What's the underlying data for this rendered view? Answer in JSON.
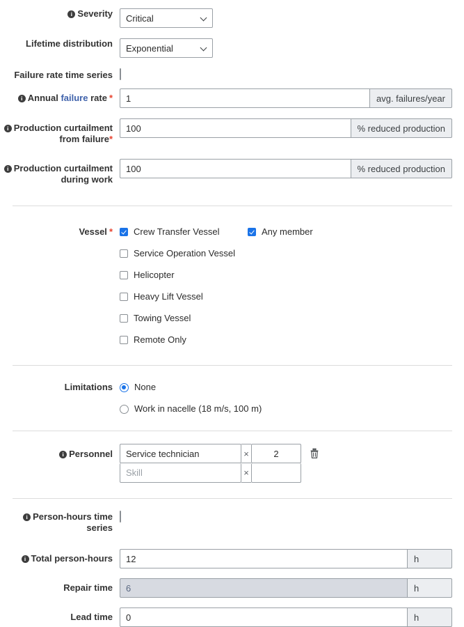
{
  "fields": {
    "severity": {
      "label": "Severity",
      "has_info": true,
      "value": "Critical",
      "options": [
        "Critical"
      ]
    },
    "lifetime_distribution": {
      "label": "Lifetime distribution",
      "has_info": false,
      "value": "Exponential",
      "options": [
        "Exponential"
      ]
    },
    "failure_rate_time_series": {
      "label": "Failure rate time series",
      "checked": false
    },
    "annual_failure_rate": {
      "label_pre": "Annual ",
      "label_link": "failure",
      "label_post": " rate",
      "required_mark": "*",
      "has_info": true,
      "value": "1",
      "unit": "avg. failures/year"
    },
    "curtailment_from_failure": {
      "label_line1": "Production curtailment",
      "label_line2": "from failure",
      "required_mark": "*",
      "has_info": true,
      "value": "100",
      "unit": "% reduced production"
    },
    "curtailment_during_work": {
      "label_line1": "Production curtailment",
      "label_line2": "during work",
      "has_info": true,
      "value": "100",
      "unit": "% reduced production"
    },
    "vessel": {
      "label": "Vessel",
      "required_mark": "*",
      "options": [
        {
          "label": "Crew Transfer Vessel",
          "checked": true
        },
        {
          "label": "Service Operation Vessel",
          "checked": false
        },
        {
          "label": "Helicopter",
          "checked": false
        },
        {
          "label": "Heavy Lift Vessel",
          "checked": false
        },
        {
          "label": "Towing Vessel",
          "checked": false
        },
        {
          "label": "Remote Only",
          "checked": false
        }
      ],
      "any_member": {
        "label": "Any member",
        "checked": true
      }
    },
    "limitations": {
      "label": "Limitations",
      "options": [
        {
          "label": "None",
          "selected": true
        },
        {
          "label": "Work in nacelle (18 m/s, 100 m)",
          "selected": false
        }
      ]
    },
    "personnel": {
      "label": "Personnel",
      "has_info": true,
      "multiply_symbol": "×",
      "rows": [
        {
          "skill": "Service technician",
          "skill_placeholder": "",
          "quantity": "2",
          "has_delete": true
        },
        {
          "skill": "",
          "skill_placeholder": "Skill",
          "quantity": "",
          "has_delete": false
        }
      ]
    },
    "person_hours_time_series": {
      "label_line1": "Person-hours time",
      "label_line2": "series",
      "has_info": true,
      "checked": false
    },
    "total_person_hours": {
      "label": "Total person-hours",
      "has_info": true,
      "value": "12",
      "unit": "h"
    },
    "repair_time": {
      "label": "Repair time",
      "has_info": false,
      "value": "6",
      "unit": "h",
      "disabled": true
    },
    "lead_time": {
      "label": "Lead time",
      "has_info": false,
      "value": "0",
      "unit": "h"
    }
  },
  "colors": {
    "accent": "#1a73e8",
    "required": "#e8432f",
    "glossary_link": "#3f62ab",
    "addon_bg": "#eceef1",
    "disabled_bg": "#d7dae1",
    "border": "#9aa0a6"
  }
}
